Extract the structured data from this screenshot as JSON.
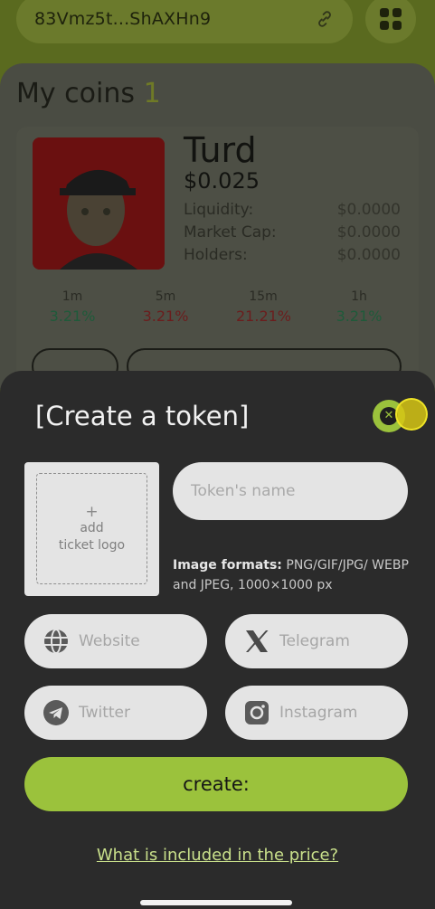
{
  "header": {
    "wallet_address": "83Vmz5t...ShAXHn9"
  },
  "my_coins": {
    "title": "My coins",
    "count": "1",
    "coin": {
      "name": "Turd",
      "price": "$0.025",
      "stats": [
        {
          "label": "Liquidity:",
          "value": "$0.0000"
        },
        {
          "label": "Market Cap:",
          "value": "$0.0000"
        },
        {
          "label": "Holders:",
          "value": "$0.0000"
        }
      ],
      "timeframes": [
        {
          "label": "1m",
          "value": "3.21%",
          "trend": "up"
        },
        {
          "label": "5m",
          "value": "3.21%",
          "trend": "down"
        },
        {
          "label": "15m",
          "value": "21.21%",
          "trend": "down"
        },
        {
          "label": "1h",
          "value": "3.21%",
          "trend": "up"
        }
      ]
    }
  },
  "modal": {
    "title": "[Create a token]",
    "logo_upload": {
      "plus": "+",
      "line1": "add",
      "line2": "ticket logo"
    },
    "token_name_placeholder": "Token's name",
    "formats_label": "Image formats:",
    "formats_text": " PNG/GIF/JPG/ WEBP and JPEG, 1000×1000 px",
    "socials": [
      {
        "placeholder": "Website",
        "icon": "globe-icon"
      },
      {
        "placeholder": "Telegram",
        "icon": "x-logo-icon"
      },
      {
        "placeholder": "Twitter",
        "icon": "telegram-icon"
      },
      {
        "placeholder": "Instagram",
        "icon": "instagram-icon"
      }
    ],
    "create_label": "create:",
    "price_link": "What is included in the price?"
  },
  "colors": {
    "accent": "#9bc23c",
    "sheet_bg": "#2b2b2b",
    "input_bg": "#e4e4e4",
    "link": "#c9e08b"
  }
}
